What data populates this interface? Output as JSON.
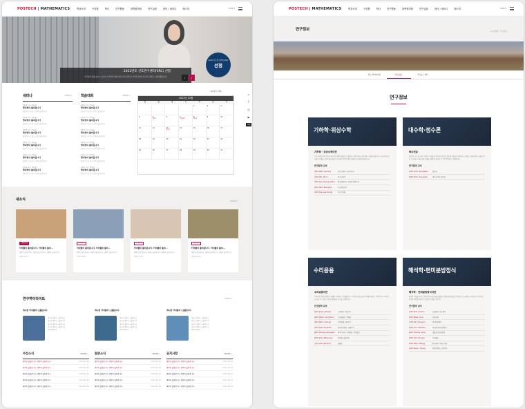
{
  "left": {
    "header": {
      "logo_brand": "POSTECH",
      "logo_dept": "MATHEMATICS",
      "nav": [
        "학과소개",
        "구성원",
        "학사",
        "연구활동",
        "대학원과정",
        "연구실정",
        "센터 / 세미나",
        "패스처"
      ],
      "lang": "KOR ▾"
    },
    "hero": {
      "caption_title": "2022년도 선도연구센터(SRC) 선정",
      "caption_desc": "수학과(학과장 김OO 교수)의 '수학기반 데이터분석 연구센터'가 한국연구재단 선도연구센터로 선정되었습니다.",
      "badge_small": "2022 선도연구센터(SRC)",
      "badge_big": "선정",
      "prev": "‹",
      "next": "›"
    },
    "seminar": {
      "title": "세미나",
      "more": "MORE +",
      "items": [
        {
          "date": "2022. 12. 05(월)",
          "title": "행사명이 들어갑니다",
          "desc": "강연자 소속 및 시간이 들어갑니다"
        },
        {
          "date": "2022. 12. 05(월)",
          "title": "행사명이 들어갑니다",
          "desc": "강연자 소속 및 시간이 들어갑니다"
        },
        {
          "date": "2022. 12. 05(월)",
          "title": "행사명이 들어갑니다",
          "desc": "강연자 소속 및 시간이 들어갑니다"
        },
        {
          "date": "2022. 12. 05(월)",
          "title": "행사명이 들어갑니다",
          "desc": "강연자 소속 및 시간이 들어갑니다"
        },
        {
          "date": "2022. 12. 05(월)",
          "title": "행사명이 들어갑니다",
          "desc": "강연자 소속 및 시간이 들어갑니다"
        },
        {
          "date": "2022. 12. 05(월)",
          "title": "행사명이 들어갑니다",
          "desc": "강연자 소속 및 시간이 들어갑니다"
        }
      ]
    },
    "conference": {
      "title": "학술대회",
      "more": "MORE +",
      "items": [
        {
          "date": "2022. 12. 05(월)",
          "title": "행사명이 들어갑니다",
          "desc": "강연자 소속 및 시간이 들어갑니다"
        },
        {
          "date": "2022. 12. 05(월)",
          "title": "행사명이 들어갑니다",
          "desc": "강연자 소속 및 시간이 들어갑니다"
        },
        {
          "date": "2022. 12. 05(월)",
          "title": "행사명이 들어갑니다",
          "desc": "강연자 소속 및 시간이 들어갑니다"
        },
        {
          "date": "2022. 12. 05(월)",
          "title": "행사명이 들어갑니다",
          "desc": "강연자 소속 및 시간이 들어갑니다"
        },
        {
          "date": "2022. 12. 05(월)",
          "title": "행사명이 들어갑니다",
          "desc": "강연자 소속 및 시간이 들어갑니다"
        },
        {
          "date": "2022. 12. 05(월)",
          "title": "행사명이 들어갑니다",
          "desc": "강연자 소속 및 시간이 들어갑니다"
        }
      ]
    },
    "calendar": {
      "nav": "‹ 2022년 12월 ›",
      "title": "2022년 12월",
      "dow": [
        "일",
        "월",
        "화",
        "수",
        "목",
        "금",
        "토"
      ],
      "days": [
        "",
        "",
        "",
        "",
        "1",
        "2",
        "3",
        "4",
        "5",
        "6",
        "7",
        "8",
        "9",
        "10",
        "11",
        "12",
        "13",
        "14",
        "15",
        "16",
        "17",
        "18",
        "19",
        "20",
        "21",
        "22",
        "23",
        "24",
        "25",
        "26",
        "27",
        "28",
        "29",
        "30",
        "31"
      ],
      "events": {
        "5": "세미나",
        "7": "학술대회",
        "8": "세미나",
        "13": "세미나"
      }
    },
    "side": {
      "search": "⌕",
      "facebook": "f",
      "instagram": "◎",
      "youtube": "▶",
      "top": "TOP"
    },
    "news": {
      "title": "새소식",
      "more": "MORE +",
      "cards": [
        {
          "cat": "행사안내",
          "title": "타이틀이 들어갑니다. 타이틀이 들어...",
          "desc": "내용이 들어갑니다. 내용이 들어갑니다. 내용이 들어갑니다.",
          "date": "2022.12.01",
          "color": "#c9a27a"
        },
        {
          "cat": "행사안내",
          "title": "타이틀이 들어갑니다. 타이틀이 들어...",
          "desc": "내용이 들어갑니다. 내용이 들어갑니다. 내용이 들어갑니다.",
          "date": "2022.12.01",
          "color": "#8aa0b8"
        },
        {
          "cat": "행사안내",
          "title": "타이틀이 들어갑니다. 타이틀이 들어...",
          "desc": "내용이 들어갑니다. 내용이 들어갑니다. 내용이 들어갑니다.",
          "date": "2022.12.01",
          "color": "#d9c6b2"
        },
        {
          "cat": "행사안내",
          "title": "타이틀이 들어갑니다. 타이틀이 들어...",
          "desc": "내용이 들어갑니다. 내용이 들어갑니다. 내용이 들어갑니다.",
          "date": "2022.12.01",
          "color": "#9c8f6a"
        }
      ]
    },
    "highlights": {
      "title": "연구하이라이트",
      "more": "MORE +",
      "cards": [
        {
          "title": "게시판 타이틀이 노출됩니다.",
          "lines": [
            "게시판 내용이 노출됩니다.",
            "게시판 내용이 노출됩니다.",
            "게시판 내용이 노출됩니다.",
            "게시판 내용이 노출됩니다.",
            "2022.12.01"
          ],
          "color": "#4a6f9a"
        },
        {
          "title": "게시판 타이틀이 노출됩니다.",
          "lines": [
            "게시판 내용이 노출됩니다.",
            "게시판 내용이 노출됩니다.",
            "게시판 내용이 노출됩니다.",
            "게시판 내용이 노출됩니다.",
            "2022.12.01"
          ],
          "color": "#3d6a8c"
        },
        {
          "title": "게시판 타이틀이 노출됩니다.",
          "lines": [
            "게시판 내용이 노출됩니다.",
            "게시판 내용이 노출됩니다.",
            "게시판 내용이 노출됩니다.",
            "게시판 내용이 노출됩니다.",
            "2022.12.01"
          ],
          "color": "#5f8fb8"
        }
      ]
    },
    "awards": {
      "title": "수상소식",
      "more": "MORE +",
      "rows": [
        {
          "t": "제목이 들어갑니다. 제목이 들어갑니다.",
          "d": "2022.12.01"
        },
        {
          "t": "제목이 들어갑니다. 제목이 들어갑니다.",
          "d": "2022.12.01"
        },
        {
          "t": "제목이 들어갑니다. 제목이 들어갑니다.",
          "d": "2022.12.01"
        },
        {
          "t": "제목이 들어갑니다. 제목이 들어갑니다.",
          "d": "2022.12.01"
        },
        {
          "t": "제목이 들어갑니다. 제목이 들어갑니다.",
          "d": "2022.12.01"
        }
      ]
    },
    "alumni": {
      "title": "동문소식",
      "more": "MORE +",
      "rows": [
        {
          "t": "제목이 들어갑니다. 제목이 들어갑니다.",
          "d": "2022.12.01"
        },
        {
          "t": "제목이 들어갑니다. 제목이 들어갑니다.",
          "d": "2022.12.01"
        },
        {
          "t": "제목이 들어갑니다. 제목이 들어갑니다.",
          "d": "2022.12.01"
        },
        {
          "t": "제목이 들어갑니다. 제목이 들어갑니다.",
          "d": "2022.12.01"
        },
        {
          "t": "제목이 들어갑니다. 제목이 들어갑니다.",
          "d": "2022.12.01"
        }
      ]
    },
    "notice": {
      "title": "공지사항",
      "more": "MORE +",
      "rows": [
        {
          "t": "제목이 들어갑니다. 제목이 들어갑니다.",
          "d": "2022.12.01"
        },
        {
          "t": "제목이 들어갑니다. 제목이 들어갑니다.",
          "d": "2022.12.01"
        },
        {
          "t": "제목이 들어갑니다. 제목이 들어갑니다.",
          "d": "2022.12.01"
        },
        {
          "t": "제목이 들어갑니다. 제목이 들어갑니다.",
          "d": "2022.12.01"
        },
        {
          "t": "제목이 들어갑니다. 제목이 들어갑니다.",
          "d": "2022.12.01"
        }
      ]
    }
  },
  "right": {
    "header": {
      "logo_brand": "POSTECH",
      "logo_dept": "MATHEMATICS",
      "nav": [
        "학과소개",
        "구성원",
        "학사",
        "연구활동",
        "대학원과정",
        "연구실정",
        "센터 / 세미나",
        "패스처"
      ],
      "lang": "KOR ▾"
    },
    "sub_title": "연구정보",
    "crumb": "⌂  연구활동  ›  연구정보",
    "tabs": [
      "연구 하이라이트",
      "연구정보",
      "연구소 / 센터"
    ],
    "active_tab": 1,
    "heading": "연구정보",
    "cards": [
      {
        "banner": "기하학·위상수학",
        "sub": "기하학 · 위상수학이란",
        "para": "순수수학의 주요 분야로 공간과 도형의 성질을 연구합니다. 미분기하학, 대수위상, 저차원 위상수학, 사교기하학 등 다양한 주제를 다루며 현대 물리학 및 여러 응용 분야와 밀접하게 연결되어 있습니다.",
        "faculty_label": "연구분야 교수",
        "faculty": [
          [
            "박OO (Park, Jae Sun)",
            "미분기하학, 사교기하학"
          ],
          [
            "오OO (Oh, Jihun)",
            "대수기하학"
          ],
          [
            "이OO (Lee, Hyung Gwan)",
            "대수위상수학, 저차원 위상수학"
          ],
          [
            "안OO (Ahn, Byungho)",
            "사교위상수학"
          ],
          [
            "이OO (Lee, Jae Seong)",
            "복소다양체"
          ]
        ]
      },
      {
        "banner": "대수학·정수론",
        "sub": "복수전공",
        "para": "대수학은 군, 환, 체 등 대수적 구조를 연구하며 정수론은 정수의 성질을 탐구합니다. 표현론, 산술기하학, 모듈러 형식 등 현대 수학의 핵심 주제를 포함하고 암호학 등 응용 분야와도 연결됩니다.",
        "faculty_label": "연구분야 교수",
        "faculty": [
          [
            "최OO (Choi, Seungbae)",
            "정수론"
          ],
          [
            "최OO (Choi, Youngook)",
            "대수기하학, 정수론"
          ]
        ]
      },
      {
        "banner": "수리응용",
        "sub": "수리응용이란",
        "para": "수치해석, 편미분방정식, 확률론, 최적화, 수리생물학 등 수학적 방법을 실제 문제에 적용하는 분야입니다. 과학·공학·금융 등 다양한 분야와 협력하여 연구를 수행합니다.",
        "faculty_label": "연구분야 교수",
        "faculty": [
          [
            "정OO (Jung, Jinhyun)",
            "수치해석, 계산수학"
          ],
          [
            "권OO (Kwon, Jae Hyeon)",
            "수리생물학, 최적화"
          ],
          [
            "박OO (Park, Il Jeung)",
            "응용확률, 금융수학"
          ],
          [
            "이OO (Lee, Sangmin)",
            "편미분방정식, 유체역학"
          ],
          [
            "황OO (Hwang, Kyungtae)",
            "데이터과학, 기계학습, 응용통계"
          ],
          [
            "임OO (Lim, Mikyoung)",
            "역문제, 영상처리"
          ],
          [
            "조OO (Cho, Jae Hun)",
            "확률론"
          ]
        ]
      },
      {
        "banner": "해석학·편미분방정식",
        "sub": "해석학 · 편미분방정식이란",
        "para": "함수와 극한을 다루는 해석학과 자연현상을 기술하는 편미분방정식을 연구합니다. 조화해석, 함수해석, 동역학계, 비선형 편미분방정식 등 폭넓은 주제를 다룹니다.",
        "faculty_label": "연구분야 교수",
        "faculty": [
          [
            "김OO (Kim, Jinwoo)",
            "조화해석, 함수해석"
          ],
          [
            "백OO (Baek, Joon)",
            "동역학계"
          ],
          [
            "오OO (Oh, Sung-Jin)",
            "편미분방정식"
          ],
          [
            "윤OO (Yun, Sehwan)",
            "비선형 편미분방정식"
          ],
          [
            "황OO (Hwang, Seok)",
            "확률 편미분방정식"
          ],
          [
            "임OO (Lim, Hye Jin)",
            "수리물리"
          ],
          [
            "박OO (Park, Kwang)",
            "함수해석, 작용소이론"
          ],
          [
            "권OO (Kwon, Young)",
            "파동방정식, 산란이론"
          ]
        ]
      }
    ]
  }
}
